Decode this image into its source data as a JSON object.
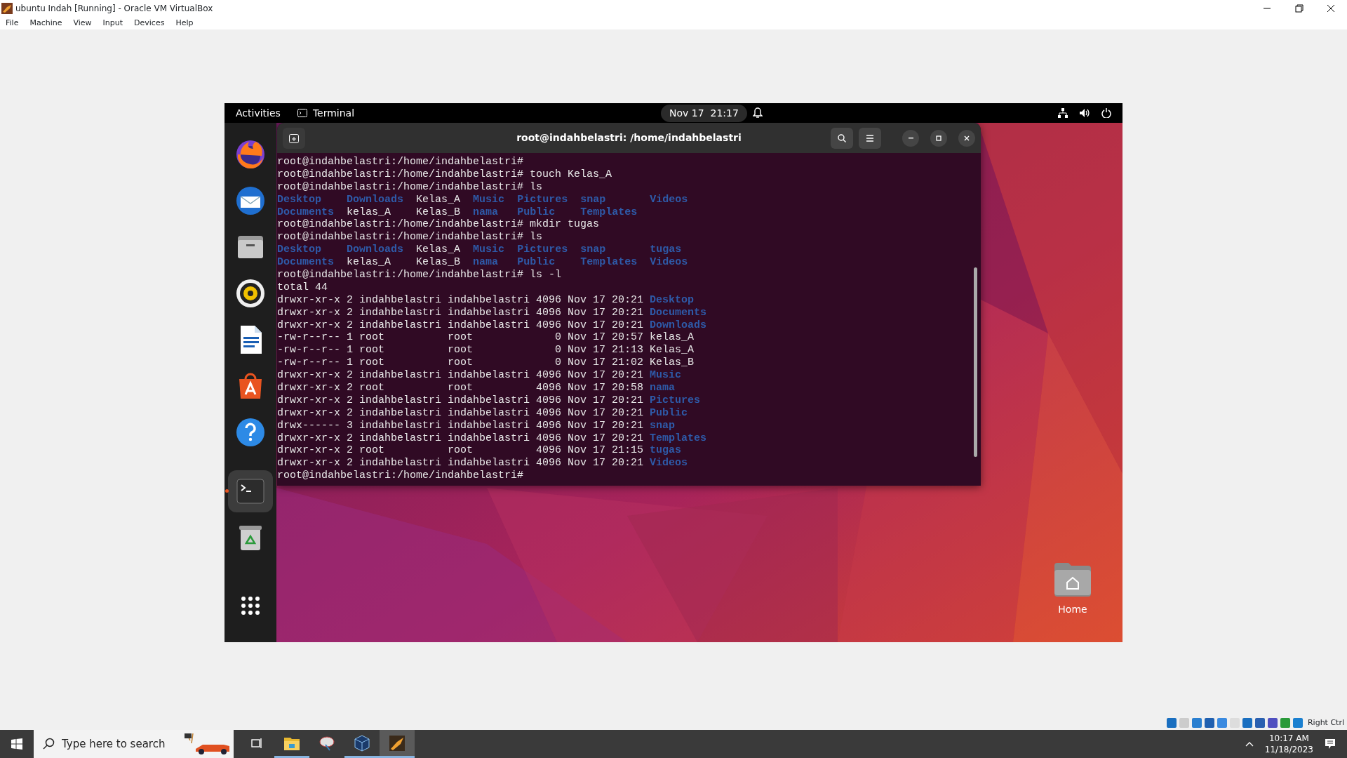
{
  "vbox": {
    "title": "ubuntu Indah [Running] - Oracle VM VirtualBox",
    "menu": [
      "File",
      "Machine",
      "View",
      "Input",
      "Devices",
      "Help"
    ],
    "host_key": "Right Ctrl"
  },
  "topbar": {
    "activities": "Activities",
    "app": "Terminal",
    "clock": "Nov 17  21:17"
  },
  "dock": [
    {
      "selected": false
    },
    {
      "selected": false
    },
    {
      "selected": false
    },
    {
      "selected": false
    },
    {
      "selected": false
    },
    {
      "selected": false
    },
    {
      "selected": false
    },
    {
      "selected": true
    },
    {
      "selected": false
    }
  ],
  "terminal": {
    "title": "root@indahbelastri: /home/indahbelastri",
    "lines": [
      {
        "kind": "prompt",
        "prompt": "root@indahbelastri:/home/indahbelastri#"
      },
      {
        "kind": "prompt",
        "prompt": "root@indahbelastri:/home/indahbelastri#",
        "command": "touch Kelas_A"
      },
      {
        "kind": "prompt",
        "prompt": "root@indahbelastri:/home/indahbelastri#",
        "command": "ls"
      },
      {
        "kind": "ls",
        "cells": [
          {
            "text": "Desktop",
            "dir": true
          },
          {
            "text": "Downloads",
            "dir": true
          },
          {
            "text": "Kelas_A",
            "dir": false
          },
          {
            "text": "Music",
            "dir": true
          },
          {
            "text": "Pictures",
            "dir": true
          },
          {
            "text": "snap",
            "dir": true
          },
          {
            "text": "Videos",
            "dir": true
          }
        ]
      },
      {
        "kind": "ls",
        "cells": [
          {
            "text": "Documents",
            "dir": true
          },
          {
            "text": "kelas_A",
            "dir": false
          },
          {
            "text": "Kelas_B",
            "dir": false
          },
          {
            "text": "nama",
            "dir": true
          },
          {
            "text": "Public",
            "dir": true
          },
          {
            "text": "Templates",
            "dir": true
          }
        ]
      },
      {
        "kind": "prompt",
        "prompt": "root@indahbelastri:/home/indahbelastri#",
        "command": "mkdir tugas"
      },
      {
        "kind": "prompt",
        "prompt": "root@indahbelastri:/home/indahbelastri#",
        "command": "ls"
      },
      {
        "kind": "ls",
        "cells": [
          {
            "text": "Desktop",
            "dir": true
          },
          {
            "text": "Downloads",
            "dir": true
          },
          {
            "text": "Kelas_A",
            "dir": false
          },
          {
            "text": "Music",
            "dir": true
          },
          {
            "text": "Pictures",
            "dir": true
          },
          {
            "text": "snap",
            "dir": true
          },
          {
            "text": "tugas",
            "dir": true
          }
        ]
      },
      {
        "kind": "ls",
        "cells": [
          {
            "text": "Documents",
            "dir": true
          },
          {
            "text": "kelas_A",
            "dir": false
          },
          {
            "text": "Kelas_B",
            "dir": false
          },
          {
            "text": "nama",
            "dir": true
          },
          {
            "text": "Public",
            "dir": true
          },
          {
            "text": "Templates",
            "dir": true
          },
          {
            "text": "Videos",
            "dir": true
          }
        ]
      },
      {
        "kind": "prompt",
        "prompt": "root@indahbelastri:/home/indahbelastri#",
        "command": "ls -l"
      },
      {
        "kind": "text",
        "text": "total 44"
      },
      {
        "kind": "long",
        "perms": "drwxr-xr-x",
        "links": "2",
        "owner": "indahbelastri",
        "group": "indahbelastri",
        "size": "4096",
        "date": "Nov 17 20:21",
        "name": "Desktop",
        "dir": true
      },
      {
        "kind": "long",
        "perms": "drwxr-xr-x",
        "links": "2",
        "owner": "indahbelastri",
        "group": "indahbelastri",
        "size": "4096",
        "date": "Nov 17 20:21",
        "name": "Documents",
        "dir": true
      },
      {
        "kind": "long",
        "perms": "drwxr-xr-x",
        "links": "2",
        "owner": "indahbelastri",
        "group": "indahbelastri",
        "size": "4096",
        "date": "Nov 17 20:21",
        "name": "Downloads",
        "dir": true
      },
      {
        "kind": "long",
        "perms": "-rw-r--r--",
        "links": "1",
        "owner": "root",
        "group": "root",
        "size": "0",
        "date": "Nov 17 20:57",
        "name": "kelas_A",
        "dir": false
      },
      {
        "kind": "long",
        "perms": "-rw-r--r--",
        "links": "1",
        "owner": "root",
        "group": "root",
        "size": "0",
        "date": "Nov 17 21:13",
        "name": "Kelas_A",
        "dir": false
      },
      {
        "kind": "long",
        "perms": "-rw-r--r--",
        "links": "1",
        "owner": "root",
        "group": "root",
        "size": "0",
        "date": "Nov 17 21:02",
        "name": "Kelas_B",
        "dir": false
      },
      {
        "kind": "long",
        "perms": "drwxr-xr-x",
        "links": "2",
        "owner": "indahbelastri",
        "group": "indahbelastri",
        "size": "4096",
        "date": "Nov 17 20:21",
        "name": "Music",
        "dir": true
      },
      {
        "kind": "long",
        "perms": "drwxr-xr-x",
        "links": "2",
        "owner": "root",
        "group": "root",
        "size": "4096",
        "date": "Nov 17 20:58",
        "name": "nama",
        "dir": true
      },
      {
        "kind": "long",
        "perms": "drwxr-xr-x",
        "links": "2",
        "owner": "indahbelastri",
        "group": "indahbelastri",
        "size": "4096",
        "date": "Nov 17 20:21",
        "name": "Pictures",
        "dir": true
      },
      {
        "kind": "long",
        "perms": "drwxr-xr-x",
        "links": "2",
        "owner": "indahbelastri",
        "group": "indahbelastri",
        "size": "4096",
        "date": "Nov 17 20:21",
        "name": "Public",
        "dir": true
      },
      {
        "kind": "long",
        "perms": "drwx------",
        "links": "3",
        "owner": "indahbelastri",
        "group": "indahbelastri",
        "size": "4096",
        "date": "Nov 17 20:21",
        "name": "snap",
        "dir": true
      },
      {
        "kind": "long",
        "perms": "drwxr-xr-x",
        "links": "2",
        "owner": "indahbelastri",
        "group": "indahbelastri",
        "size": "4096",
        "date": "Nov 17 20:21",
        "name": "Templates",
        "dir": true
      },
      {
        "kind": "long",
        "perms": "drwxr-xr-x",
        "links": "2",
        "owner": "root",
        "group": "root",
        "size": "4096",
        "date": "Nov 17 21:15",
        "name": "tugas",
        "dir": true
      },
      {
        "kind": "long",
        "perms": "drwxr-xr-x",
        "links": "2",
        "owner": "indahbelastri",
        "group": "indahbelastri",
        "size": "4096",
        "date": "Nov 17 20:21",
        "name": "Videos",
        "dir": true
      },
      {
        "kind": "prompt",
        "prompt": "root@indahbelastri:/home/indahbelastri#"
      }
    ]
  },
  "desktop_icons": [
    {
      "label": "Home"
    }
  ],
  "taskbar": {
    "search": {
      "placeholder": "Type here to search"
    },
    "apps": [
      {
        "running": true,
        "selected": false
      },
      {
        "running": false,
        "selected": false
      },
      {
        "running": true,
        "selected": false
      },
      {
        "running": true,
        "selected": true
      }
    ],
    "time": "10:17 AM",
    "date": "11/18/2023"
  }
}
